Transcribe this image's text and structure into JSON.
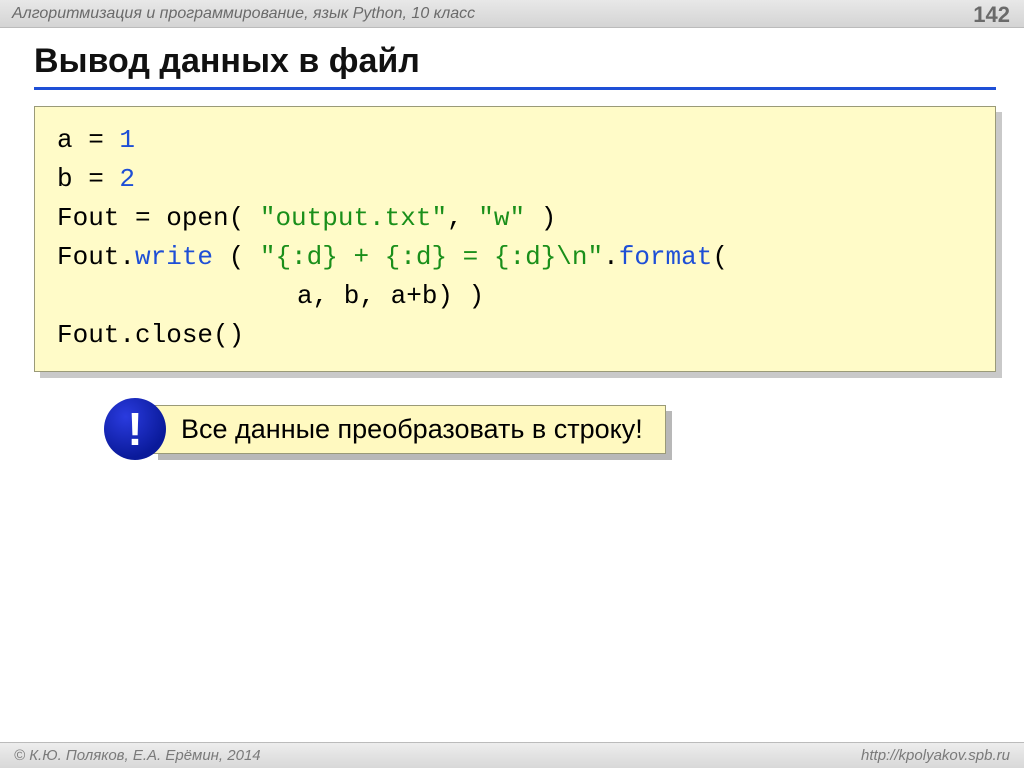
{
  "header": {
    "breadcrumb": "Алгоритмизация и программирование, язык Python, 10 класс",
    "page_number": "142"
  },
  "title": "Вывод данных в файл",
  "code": {
    "l1_a": "a = ",
    "l1_b": "1",
    "l2_a": "b = ",
    "l2_b": "2",
    "l3_a": "Fout = open( ",
    "l3_b": "\"output.txt\"",
    "l3_c": ", ",
    "l3_d": "\"w\"",
    "l3_e": " )",
    "l4_a": "Fout.",
    "l4_b": "write",
    "l4_c": " ( ",
    "l4_d": "\"{:d} + {:d} = {:d}\\n\"",
    "l4_e": ".",
    "l4_f": "format",
    "l4_g": "(",
    "l5": "a, b, a+b) )",
    "l6": "Fout.close()"
  },
  "note": {
    "badge": "!",
    "text": "Все данные преобразовать в строку!"
  },
  "footer": {
    "left": "© К.Ю. Поляков, Е.А. Ерёмин, 2014",
    "right": "http://kpolyakov.spb.ru"
  }
}
